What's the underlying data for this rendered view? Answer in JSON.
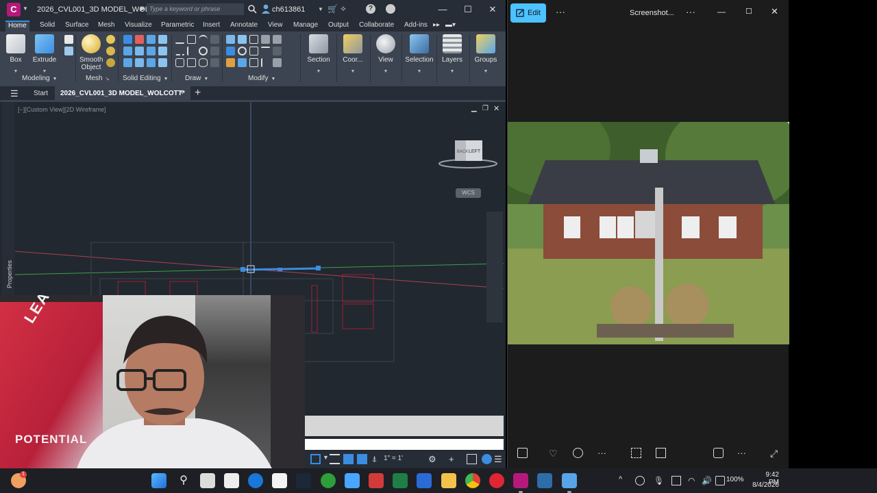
{
  "cad": {
    "app_letter": "C",
    "filename": "2026_CVL001_3D MODEL_WOL...",
    "search_placeholder": "Type a keyword or phrase",
    "username": "ch613861",
    "help_icon": "?",
    "minimize": "—",
    "maximize": "☐",
    "close": "✕",
    "ribbon_tabs": [
      "Home",
      "Solid",
      "Surface",
      "Mesh",
      "Visualize",
      "Parametric",
      "Insert",
      "Annotate",
      "View",
      "Manage",
      "Output",
      "Collaborate",
      "Add-ins"
    ],
    "active_tab": "Home",
    "buttons": {
      "box": "Box",
      "extrude": "Extrude",
      "smooth_line1": "Smooth",
      "smooth_line2": "Object",
      "section": "Section",
      "coordinates": "Coor...",
      "view": "View",
      "selection": "Selection",
      "layers": "Layers",
      "groups": "Groups"
    },
    "panels": {
      "modeling": "Modeling",
      "mesh": "Mesh",
      "solid_editing": "Solid Editing",
      "draw": "Draw",
      "modify": "Modify"
    },
    "file_tabs": {
      "start": "Start",
      "drawing": "2026_CVL001_3D MODEL_WOLCOTT*"
    },
    "viewport": {
      "label": "[−][Custom View][2D Wireframe]",
      "properties": "Properties",
      "viewcube_face1": "LEFT",
      "viewcube_face2": "BACK",
      "wcs": "WCS"
    },
    "status": {
      "scale": "1\" = 1'"
    },
    "colors": {
      "background": "#1f2630",
      "ribbon": "#3b4450",
      "logo": "#b5197a",
      "accent": "#3a8de0"
    }
  },
  "webcam": {
    "banner_text1": "LEASH",
    "banner_text2": "POTENTIAL"
  },
  "photos": {
    "edit_label": "Edit",
    "title": "Screenshot...",
    "more": "···",
    "minimize": "—",
    "maximize": "☐",
    "close": "✕",
    "accent": "#4cc2ff"
  },
  "taskbar": {
    "battery": "100%",
    "time": "9:42 PM",
    "date": "8/4/2026",
    "weather_badge": "1"
  }
}
